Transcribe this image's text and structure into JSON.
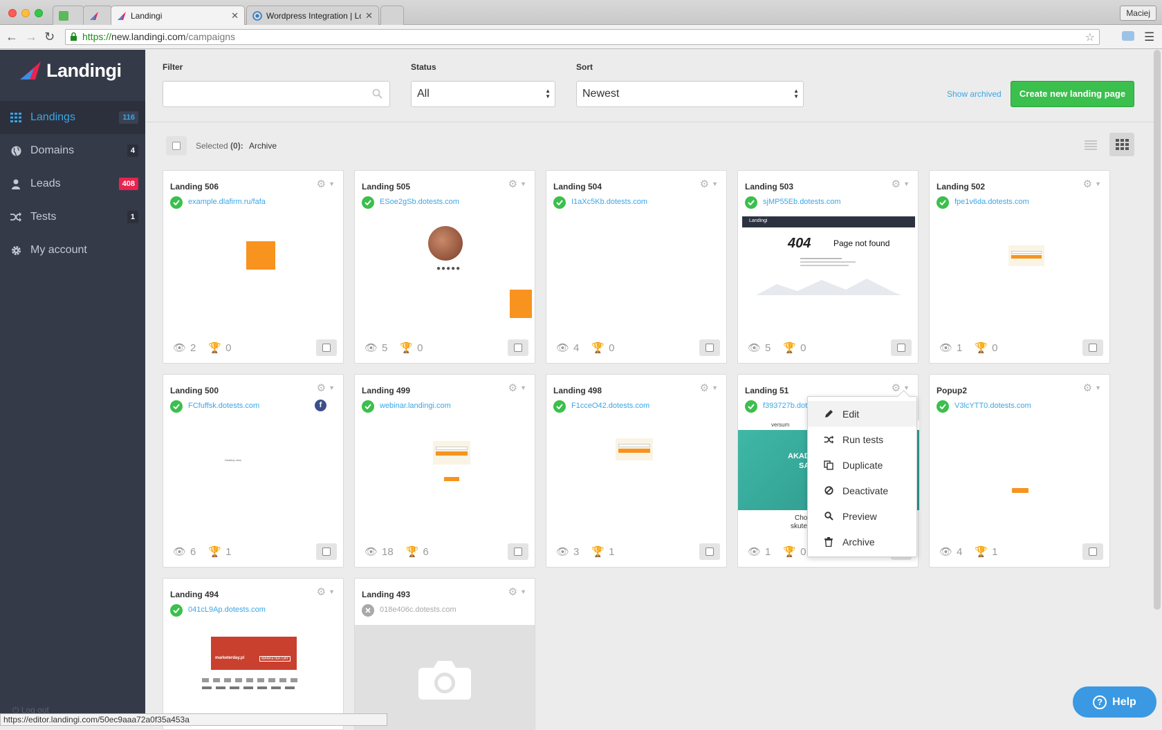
{
  "browser": {
    "tabs": [
      {
        "label": ""
      },
      {
        "label": ""
      },
      {
        "label": "Landingi"
      },
      {
        "label": "Wordpress Integration | Lo"
      },
      {
        "label": ""
      }
    ],
    "profile": "Maciej",
    "url_scheme": "https://",
    "url_host": "new.landingi.com",
    "url_path": "/campaigns",
    "status_url": "https://editor.landingi.com/50ec9aaa72a0f35a453a"
  },
  "sidebar": {
    "brand": "Landingi",
    "items": [
      {
        "label": "Landings",
        "badge": "116",
        "icon": "grid-icon"
      },
      {
        "label": "Domains",
        "badge": "4",
        "icon": "globe-icon"
      },
      {
        "label": "Leads",
        "badge": "408",
        "icon": "user-icon"
      },
      {
        "label": "Tests",
        "badge": "1",
        "icon": "shuffle-icon"
      },
      {
        "label": "My account",
        "badge": "",
        "icon": "gear-icon"
      }
    ],
    "logout": "Log out"
  },
  "filters": {
    "filter_label": "Filter",
    "filter_value": "",
    "filter_placeholder": "",
    "status_label": "Status",
    "status_value": "All",
    "sort_label": "Sort",
    "sort_value": "Newest",
    "show_archived": "Show archived",
    "create_button": "Create new landing page"
  },
  "selection": {
    "selected_label": "Selected",
    "selected_count": "(0):",
    "archive": "Archive"
  },
  "cards": [
    {
      "title": "Landing 506",
      "url": "example.dlafirm.ru/fafa",
      "active": true,
      "views": "2",
      "conversions": "0"
    },
    {
      "title": "Landing 505",
      "url": "ESoe2gSb.dotests.com",
      "active": true,
      "views": "5",
      "conversions": "0"
    },
    {
      "title": "Landing 504",
      "url": "I1aXc5Kb.dotests.com",
      "active": true,
      "views": "4",
      "conversions": "0"
    },
    {
      "title": "Landing 503",
      "url": "sjMP55Eb.dotests.com",
      "active": true,
      "views": "5",
      "conversions": "0"
    },
    {
      "title": "Landing 502",
      "url": "fpe1v6da.dotests.com",
      "active": true,
      "views": "1",
      "conversions": "0"
    },
    {
      "title": "Landing 500",
      "url": "FCfuffsk.dotests.com",
      "active": true,
      "views": "6",
      "conversions": "1"
    },
    {
      "title": "Landing 499",
      "url": "webinar.landingi.com",
      "active": true,
      "views": "18",
      "conversions": "6"
    },
    {
      "title": "Landing 498",
      "url": "F1cceO42.dotests.com",
      "active": true,
      "views": "3",
      "conversions": "1"
    },
    {
      "title": "Landing 51",
      "url": "f393727b.dot",
      "active": true,
      "views": "1",
      "conversions": "0"
    },
    {
      "title": "Popup2",
      "url": "V3lcYTT0.dotests.com",
      "active": true,
      "views": "4",
      "conversions": "1"
    },
    {
      "title": "Landing 494",
      "url": "041cL9Ap.dotests.com",
      "active": true,
      "views": "",
      "conversions": ""
    },
    {
      "title": "Landing 493",
      "url": "018e406c.dotests.com",
      "active": false,
      "views": "",
      "conversions": ""
    }
  ],
  "previews": {
    "p503_logo": "Landingi",
    "p503_code": "404",
    "p503_text": "Page not found",
    "p500_text": "Desktop view",
    "p494_site": "marketerday.pl",
    "p494_badge": "MARKETER DAY",
    "p51_brand": "versum",
    "p51_head": "AKADI",
    "p51_sub": "SA",
    "p51_foot1": "Cho",
    "p51_foot2": "skute"
  },
  "context_menu": {
    "items": [
      {
        "label": "Edit",
        "icon": "pencil-icon"
      },
      {
        "label": "Run tests",
        "icon": "shuffle-icon"
      },
      {
        "label": "Duplicate",
        "icon": "copy-icon"
      },
      {
        "label": "Deactivate",
        "icon": "ban-icon"
      },
      {
        "label": "Preview",
        "icon": "magnifier-icon"
      },
      {
        "label": "Archive",
        "icon": "trash-icon"
      }
    ]
  },
  "help": {
    "label": "Help"
  },
  "colors": {
    "sidebar_bg": "#353a48",
    "accent_blue": "#3aa6e6",
    "create_green": "#3bbf4d",
    "badge_red": "#e8234f",
    "preview_orange": "#f7931e"
  }
}
